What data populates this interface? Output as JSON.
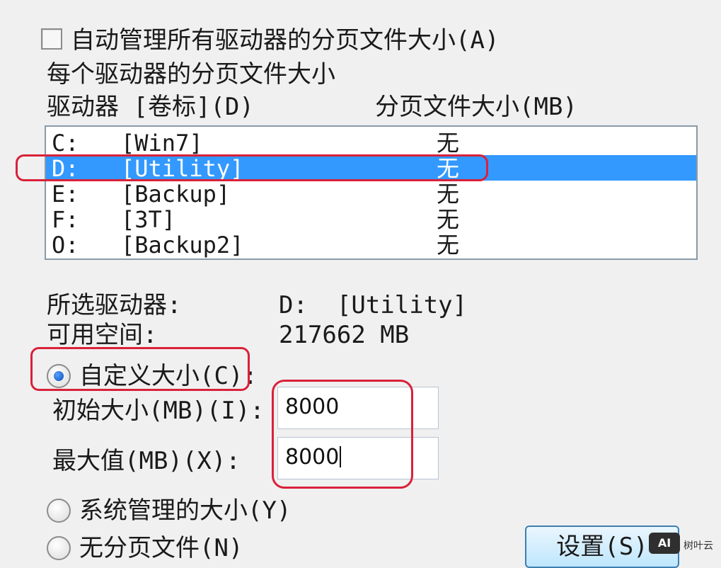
{
  "auto_manage": {
    "label": "自动管理所有驱动器的分页文件大小(A)",
    "checked": false
  },
  "group_title": "每个驱动器的分页文件大小",
  "list_headers": {
    "drive": "驱动器 [卷标](D)",
    "size": "分页文件大小(MB)"
  },
  "drives": [
    {
      "letter": "C:",
      "label": "[Win7]",
      "size": "无",
      "selected": false
    },
    {
      "letter": "D:",
      "label": "[Utility]",
      "size": "无",
      "selected": true
    },
    {
      "letter": "E:",
      "label": "[Backup]",
      "size": "无",
      "selected": false
    },
    {
      "letter": "F:",
      "label": "[3T]",
      "size": "无",
      "selected": false
    },
    {
      "letter": "O:",
      "label": "[Backup2]",
      "size": "无",
      "selected": false
    }
  ],
  "selected_drive": {
    "label": "所选驱动器:",
    "value": "D:  [Utility]"
  },
  "free_space": {
    "label": "可用空间:",
    "value": "217662 MB"
  },
  "custom_size": {
    "label": "自定义大小(C):",
    "checked": true,
    "initial": {
      "label": "初始大小(MB)(I):",
      "value": "8000"
    },
    "maximum": {
      "label": "最大值(MB)(X):",
      "value": "8000"
    }
  },
  "system_managed": {
    "label": "系统管理的大小(Y)",
    "checked": false
  },
  "no_paging": {
    "label": "无分页文件(N)",
    "checked": false
  },
  "set_button": "设置(S)",
  "watermark": {
    "badge": "AI",
    "text": "树叶云"
  },
  "colors": {
    "selection": "#3399ff",
    "annotation": "#d9213a"
  }
}
